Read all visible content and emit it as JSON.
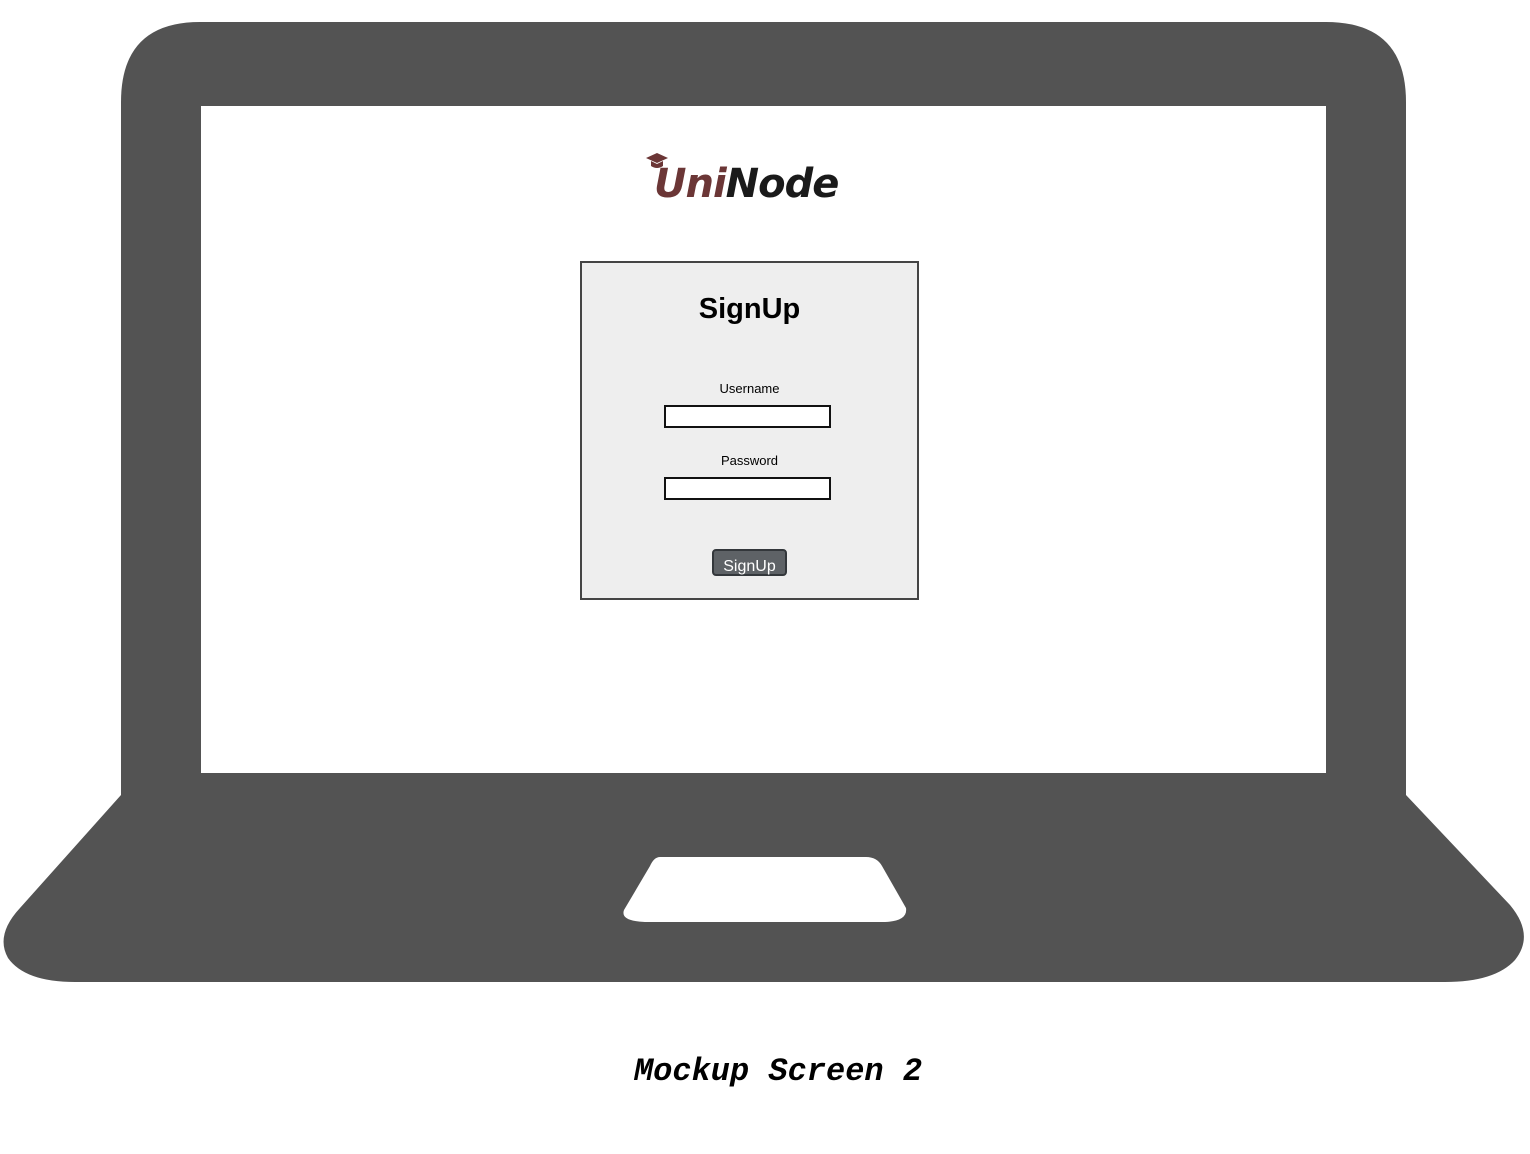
{
  "logo": {
    "uni": "Uni",
    "node": "Node",
    "cap_icon": "graduation-cap-icon"
  },
  "signup_form": {
    "title": "SignUp",
    "username_label": "Username",
    "username_value": "",
    "password_label": "Password",
    "password_value": "",
    "submit_label": "SignUp"
  },
  "caption": "Mockup Screen 2",
  "colors": {
    "laptop_body": "#535353",
    "panel_bg": "#eeeeee",
    "button_bg": "#5e6266",
    "logo_uni": "#6b3636",
    "logo_node": "#1a1a1a"
  }
}
